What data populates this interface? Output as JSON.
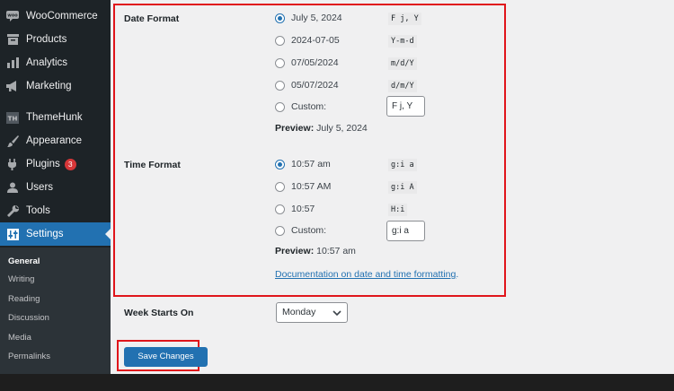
{
  "sidebar": {
    "items": [
      {
        "label": "WooCommerce",
        "icon": "woocommerce-icon"
      },
      {
        "label": "Products",
        "icon": "archive-icon"
      },
      {
        "label": "Analytics",
        "icon": "bar-chart-icon"
      },
      {
        "label": "Marketing",
        "icon": "megaphone-icon"
      },
      {
        "label": "ThemeHunk",
        "icon": "themehunk-icon",
        "icon_text": "TH"
      },
      {
        "label": "Appearance",
        "icon": "paintbrush-icon"
      },
      {
        "label": "Plugins",
        "icon": "plug-icon",
        "badge": "3"
      },
      {
        "label": "Users",
        "icon": "user-icon"
      },
      {
        "label": "Tools",
        "icon": "wrench-icon"
      },
      {
        "label": "Settings",
        "icon": "settings-icon"
      }
    ],
    "submenu": [
      "General",
      "Writing",
      "Reading",
      "Discussion",
      "Media",
      "Permalinks"
    ],
    "accent_color": "#2271b1"
  },
  "date_format": {
    "label": "Date Format",
    "options": [
      {
        "label": "July 5, 2024",
        "code": "F j, Y",
        "checked": true
      },
      {
        "label": "2024-07-05",
        "code": "Y-m-d",
        "checked": false
      },
      {
        "label": "07/05/2024",
        "code": "m/d/Y",
        "checked": false
      },
      {
        "label": "05/07/2024",
        "code": "d/m/Y",
        "checked": false
      }
    ],
    "custom_label": "Custom:",
    "custom_value": "F j, Y",
    "preview_label": "Preview:",
    "preview_value": "July 5, 2024"
  },
  "time_format": {
    "label": "Time Format",
    "options": [
      {
        "label": "10:57 am",
        "code": "g:i a",
        "checked": true
      },
      {
        "label": "10:57 AM",
        "code": "g:i A",
        "checked": false
      },
      {
        "label": "10:57",
        "code": "H:i",
        "checked": false
      }
    ],
    "custom_label": "Custom:",
    "custom_value": "g:i a",
    "preview_label": "Preview:",
    "preview_value": "10:57 am"
  },
  "doc_link": {
    "text": "Documentation on date and time formatting",
    "suffix": "."
  },
  "week_starts": {
    "label": "Week Starts On",
    "value": "Monday"
  },
  "save_button": "Save Changes",
  "highlight_color": "#e0151b"
}
